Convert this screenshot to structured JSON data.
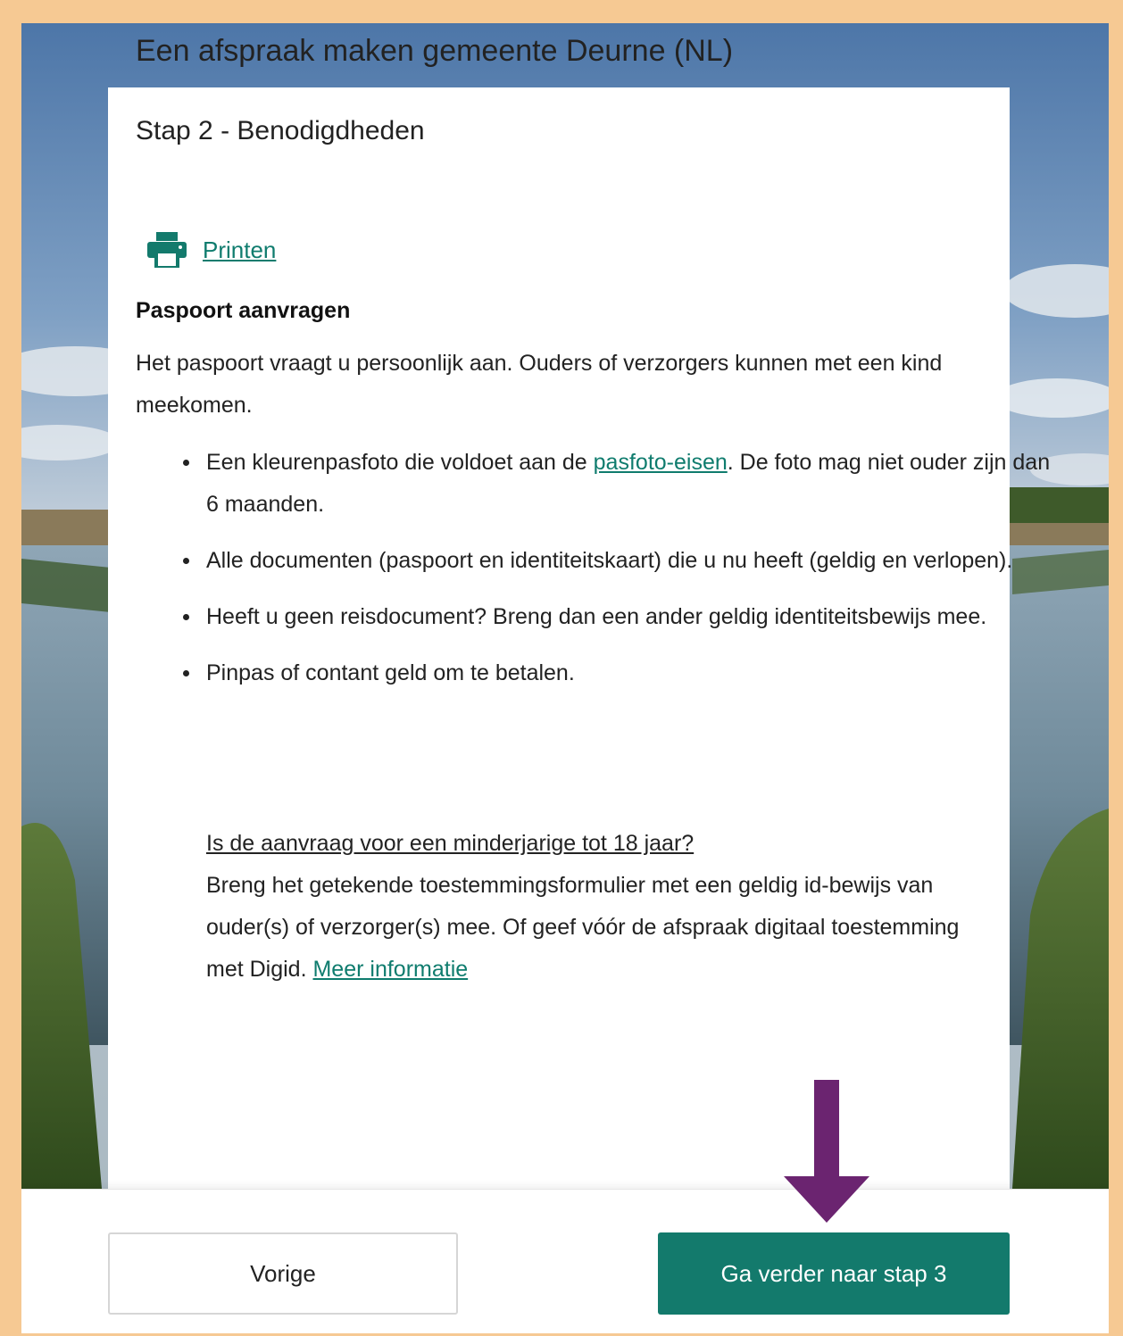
{
  "header": {
    "title": "Een afspraak maken gemeente Deurne (NL)"
  },
  "step": {
    "title": "Stap 2 - Benodigdheden"
  },
  "print": {
    "icon": "printer-icon",
    "label": "Printen"
  },
  "section": {
    "heading": "Paspoort aanvragen",
    "intro": "Het paspoort vraagt u persoonlijk aan. Ouders of verzorgers kunnen met een kind meekomen."
  },
  "requirements": {
    "item1": {
      "before": "Een kleurenpasfoto die voldoet aan de ",
      "link": "pasfoto-eisen",
      "after": ". De foto mag niet ouder zijn dan 6 maanden."
    },
    "item2": "Alle documenten (paspoort en identiteitskaart) die u nu heeft (geldig en verlopen).",
    "item3": "Heeft u geen reisdocument? Breng dan een ander geldig identiteitsbewijs mee.",
    "item4": "Pinpas of contant geld om te betalen."
  },
  "minor": {
    "question": "Is de aanvraag voor een minderjarige tot 18 jaar? ",
    "text": "Breng het getekende toestemmingsformulier met een geldig id-bewijs van ouder(s) of verzorger(s) mee. Of geef vóór de afspraak digitaal toestemming met Digid. ",
    "link": "Meer informatie"
  },
  "footer": {
    "prev_label": "Vorige",
    "next_label": "Ga verder naar stap 3"
  },
  "colors": {
    "accent": "#137a6c",
    "link": "#0f7c6e",
    "frame": "#f6c993",
    "annotation_arrow": "#6b2470"
  }
}
